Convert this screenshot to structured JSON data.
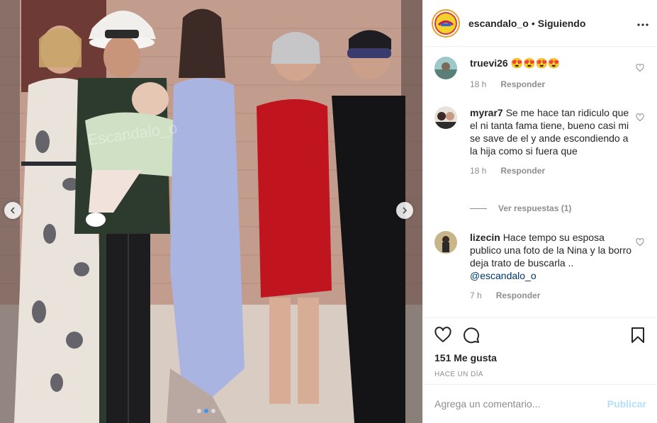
{
  "post": {
    "username": "escandalo_o",
    "separator": "•",
    "follow_status": "Siguiendo",
    "more_icon": "more-horizontal-icon",
    "avatar_text": "ESCANDALO",
    "watermark": "Escandalo_o"
  },
  "comments": [
    {
      "username": "truevi26",
      "text": "😍😍😍😍",
      "time": "18 h",
      "reply_label": "Responder"
    },
    {
      "username": "myrar7",
      "text": "Se me hace tan ridiculo que el ni tanta fama tiene, bueno casi mi se save de el y ande escondiendo a la hija como si fuera que",
      "time": "18 h",
      "reply_label": "Responder"
    },
    {
      "username": "lizecin",
      "text": "Hace tempo su esposa publico una foto de la Nina y la borro deja trato de buscarla ..",
      "mention": "@escandalo_o",
      "time": "7 h",
      "reply_label": "Responder"
    }
  ],
  "view_replies": "Ver respuestas (1)",
  "likes": "151 Me gusta",
  "posted": "HACE UN DÍA",
  "composer": {
    "placeholder": "Agrega un comentario...",
    "publish_label": "Publicar"
  },
  "colors": {
    "accent_blue": "#3897f0",
    "publish_disabled": "#b2dffc",
    "text": "#262626",
    "muted": "#8e8e8e"
  },
  "carousel": {
    "dot_count": 3,
    "active_index": 1
  }
}
